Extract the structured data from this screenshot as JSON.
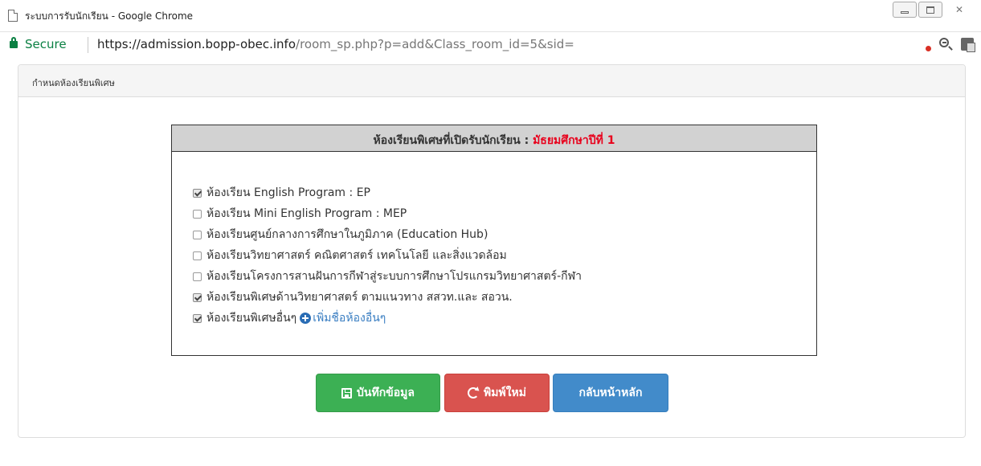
{
  "window": {
    "title": "ระบบการรับนักเรียน - Google Chrome"
  },
  "addressbar": {
    "secure_label": "Secure",
    "url_host": "https://admission.bopp-obec.info",
    "url_path": "/room_sp.php?p=add&Class_room_id=5&sid="
  },
  "icons": {
    "page": "page-icon",
    "lock": "lock-icon",
    "extensions": [
      "shield-extension-icon",
      "zoom-out-icon",
      "translate-icon"
    ]
  },
  "panel": {
    "heading": "กำหนดห้องเรียนพิเศษ"
  },
  "box": {
    "header_label": "ห้องเรียนพิเศษที่เปิดรับนักเรียน : ",
    "header_grade": "มัธยมศึกษาปีที่ 1",
    "grade_color": "#e8001c"
  },
  "options": [
    {
      "label": "ห้องเรียน English Program : EP",
      "checked": true
    },
    {
      "label": "ห้องเรียน Mini English Program : MEP",
      "checked": false
    },
    {
      "label": "ห้องเรียนศูนย์กลางการศึกษาในภูมิภาค (Education Hub)",
      "checked": false
    },
    {
      "label": "ห้องเรียนวิทยาศาสตร์ คณิตศาสตร์ เทคโนโลยี และสิ่งแวดล้อม",
      "checked": false
    },
    {
      "label": "ห้องเรียนโครงการสานฝันการกีฬาสู่ระบบการศึกษาโปรแกรมวิทยาศาสตร์-กีฬา",
      "checked": false
    },
    {
      "label": "ห้องเรียนพิเศษด้านวิทยาศาสตร์ ตามแนวทาง สสวท.และ สอวน.",
      "checked": true
    },
    {
      "label": "ห้องเรียนพิเศษอื่นๆ",
      "checked": true
    }
  ],
  "add_other_link": "เพิ่มชื่อห้องอื่นๆ",
  "buttons": {
    "save": "บันทึกข้อมูล",
    "reset": "พิมพ์ใหม่",
    "home": "กลับหน้าหลัก"
  },
  "colors": {
    "save": "#3cb054",
    "reset": "#d9534f",
    "home": "#428bca",
    "secure": "#0b8043"
  }
}
